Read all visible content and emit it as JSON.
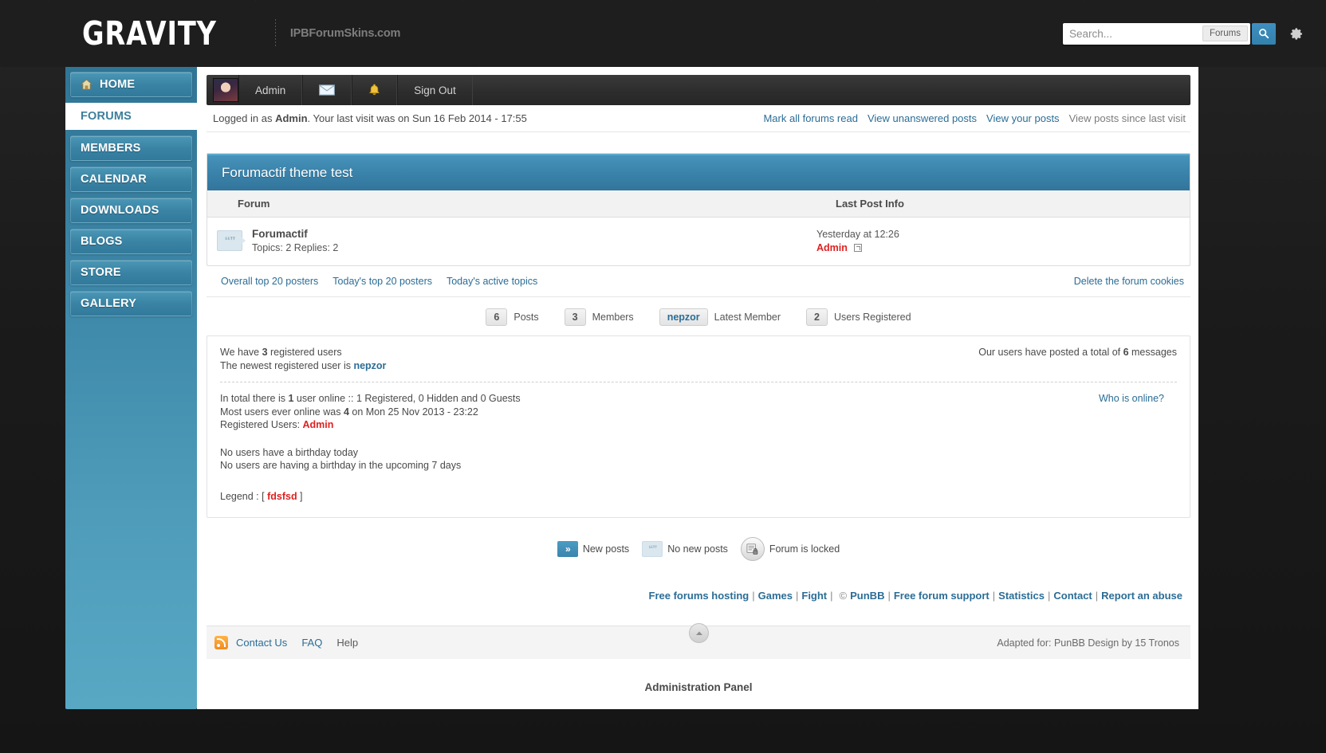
{
  "header": {
    "logo": "GRAVITY",
    "tagline": "IPBForumSkins.com",
    "search": {
      "placeholder": "Search...",
      "value": "",
      "scope_label": "Forums",
      "search_icon": "search-icon",
      "gear_icon": "gear-icon"
    }
  },
  "sidebar": {
    "items": [
      {
        "label": "HOME",
        "icon": "home-icon",
        "active": false
      },
      {
        "label": "FORUMS",
        "icon": "",
        "active": true
      },
      {
        "label": "MEMBERS",
        "icon": "",
        "active": false
      },
      {
        "label": "CALENDAR",
        "icon": "",
        "active": false
      },
      {
        "label": "DOWNLOADS",
        "icon": "",
        "active": false
      },
      {
        "label": "BLOGS",
        "icon": "",
        "active": false
      },
      {
        "label": "STORE",
        "icon": "",
        "active": false
      },
      {
        "label": "GALLERY",
        "icon": "",
        "active": false
      }
    ]
  },
  "userbar": {
    "avatar": "user-avatar",
    "username": "Admin",
    "messages_icon": "envelope-icon",
    "notifications_icon": "bell-icon",
    "signout_label": "Sign Out"
  },
  "loginbar": {
    "prefix": "Logged in as ",
    "user": "Admin",
    "suffix": ". Your last visit was on Sun 16 Feb 2014 - 17:55",
    "links": [
      {
        "label": "Mark all forums read",
        "muted": false
      },
      {
        "label": "View unanswered posts",
        "muted": false
      },
      {
        "label": "View your posts",
        "muted": false
      },
      {
        "label": "View posts since last visit",
        "muted": true
      }
    ]
  },
  "category": {
    "title": "Forumactif theme test",
    "columns": {
      "forum": "Forum",
      "last_post": "Last Post Info"
    },
    "rows": [
      {
        "icon": "quote-bubble-icon",
        "name": "Forumactif",
        "stats": "Topics: 2 Replies: 2",
        "last_post_date": "Yesterday at 12:26",
        "last_post_author": "Admin",
        "goto_icon": "goto-last-post-icon"
      }
    ]
  },
  "toplinks": {
    "left": [
      "Overall top 20 posters",
      "Today's top 20 posters",
      "Today's active topics"
    ],
    "right": "Delete the forum cookies"
  },
  "stats_row": [
    {
      "count": "6",
      "label": "Posts",
      "is_link": false
    },
    {
      "count": "3",
      "label": "Members",
      "is_link": false
    },
    {
      "count": "nepzor",
      "label": "Latest Member",
      "is_link": true
    },
    {
      "count": "2",
      "label": "Users Registered",
      "is_link": false
    }
  ],
  "info": {
    "registered_prefix": "We have ",
    "registered_count": "3",
    "registered_suffix": " registered users",
    "newest_prefix": "The newest registered user is ",
    "newest_user": "nepzor",
    "total_posts_prefix": "Our users have posted a total of ",
    "total_posts_count": "6",
    "total_posts_suffix": " messages",
    "online_prefix": "In total there is ",
    "online_count": "1",
    "online_suffix": " user online :: 1 Registered, 0 Hidden and 0 Guests",
    "record_prefix": "Most users ever online was ",
    "record_count": "4",
    "record_suffix": " on Mon 25 Nov 2013 - 23:22",
    "registered_users_label": "Registered Users: ",
    "registered_users_value": "Admin",
    "who_online_link": "Who is online?",
    "birthday_today": "No users have a birthday today",
    "birthday_upcoming": "No users are having a birthday in the upcoming 7 days",
    "legend_label": "Legend :  [ ",
    "legend_group": "fdsfsd",
    "legend_close": " ]"
  },
  "key": {
    "new_posts": "New posts",
    "no_new_posts": "No new posts",
    "locked": "Forum is locked",
    "new_icon": "new-posts-icon",
    "nonew_icon": "no-new-posts-icon",
    "lock_icon": "locked-forum-icon"
  },
  "footer_links": [
    "Free forums hosting",
    "Games",
    "Fight",
    "PunBB",
    "Free forum support",
    "Statistics",
    "Contact",
    "Report an abuse"
  ],
  "footer_separators": {
    "pipe": "|",
    "copyright": "©"
  },
  "footbar": {
    "rss_icon": "rss-icon",
    "contact": "Contact Us",
    "faq": "FAQ",
    "help": "Help",
    "scroll_top_icon": "scroll-to-top-icon",
    "credit": "Adapted for: PunBB Design by 15 Tronos"
  },
  "admin_panel_label": "Administration Panel",
  "colors": {
    "accent_blue": "#3b85ac",
    "link_blue": "#2b6d96",
    "red": "#e02020",
    "sidebar_top": "#2f7596",
    "sidebar_bottom": "#58a8c4"
  }
}
